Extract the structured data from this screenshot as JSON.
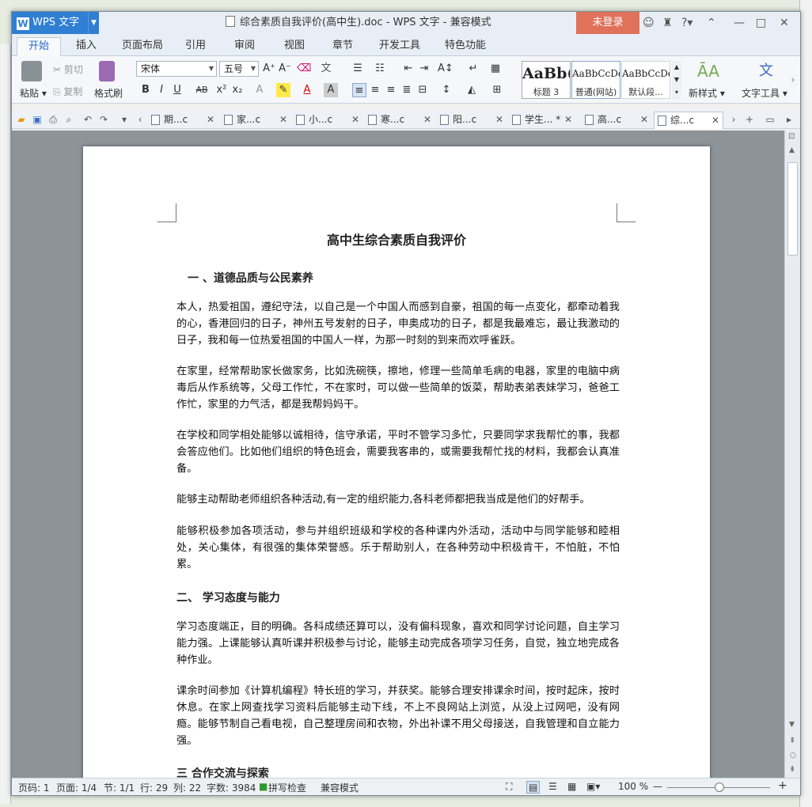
{
  "window": {
    "app_button": "WPS 文字",
    "title": "综合素质自我评价(高中生).doc - WPS 文字 - 兼容模式",
    "login": "未登录"
  },
  "menu_tabs": [
    "开始",
    "插入",
    "页面布局",
    "引用",
    "审阅",
    "视图",
    "章节",
    "开发工具",
    "特色功能"
  ],
  "ribbon": {
    "paste": "粘贴",
    "cut": "剪切",
    "copy": "复制",
    "format_painter": "格式刷",
    "font_name": "宋体",
    "font_size": "五号",
    "styles": [
      {
        "sample": "AaBb(",
        "name": "标题 3"
      },
      {
        "sample": "AaBbCcDd",
        "name": "普通(网站)"
      },
      {
        "sample": "AaBbCcDd",
        "name": "默认段..."
      }
    ],
    "new_style": "新样式",
    "text_tools": "文字工具"
  },
  "doc_tabs": [
    "期...c",
    "家...c",
    "小...c",
    "寒...c",
    "阳...c",
    "学生... *",
    "高...c",
    "综...c"
  ],
  "document": {
    "title": "高中生综合素质自我评价",
    "heading1": "一 、道德品质与公民素养",
    "p1": "本人，热爱祖国，遵纪守法，以自己是一个中国人而感到自豪，祖国的每一点变化，都牵动着我的心，香港回归的日子，神州五号发射的日子，申奥成功的日子，都是我最难忘，最让我激动的日子，我和每一位热爱祖国的中国人一样，为那一时刻的到来而欢呼雀跃。",
    "p2": "在家里，经常帮助家长做家务，比如洗碗筷，擦地，修理一些简单毛病的电器，家里的电脑中病毒后从作系统等，父母工作忙，不在家时，可以做一些简单的饭菜，帮助表弟表妹学习，爸爸工作忙，家里的力气活，都是我帮妈妈干。",
    "p3": "在学校和同学相处能够以诚相待，信守承诺，平时不管学习多忙，只要同学求我帮忙的事，我都会答应他们。比如他们组织的特色班会，需要我客串的，或需要我帮忙找的材料，我都会认真准备。",
    "p4": "能够主动帮助老师组织各种活动,有一定的组织能力,各科老师都把我当成是他们的好帮手。",
    "p5": "能够积极参加各项活动，参与并组织班级和学校的各种课内外活动，活动中与同学能够和睦相处，关心集体，有很强的集体荣誉感。乐于帮助别人，在各种劳动中积极肯干，不怕脏，不怕累。",
    "heading2": "二、 学习态度与能力",
    "p6": "学习态度端正，目的明确。各科成绩还算可以，没有偏科现象，喜欢和同学讨论问题，自主学习能力强。上课能够认真听课并积极参与讨论，能够主动完成各项学习任务，自觉，独立地完成各种作业。",
    "p7": "课余时间参加《计算机编程》特长班的学习，并获奖。能够合理安排课余时间，按时起床，按时休息。在家上网查找学习资料后能够主动下线，不上不良网站上浏览，从没上过网吧，没有网瘾。能够节制自己看电视，自己整理房间和衣物，外出补课不用父母接送，自我管理和自立能力强。",
    "heading3": "三 合作交流与探索"
  },
  "status": {
    "page_num": "页码: 1",
    "pages": "页面: 1/4",
    "section": "节: 1/1",
    "row": "行: 29",
    "col": "列: 22",
    "chars": "字数: 3984",
    "spell": "拼写检查",
    "compat": "兼容模式",
    "zoom": "100 %"
  }
}
